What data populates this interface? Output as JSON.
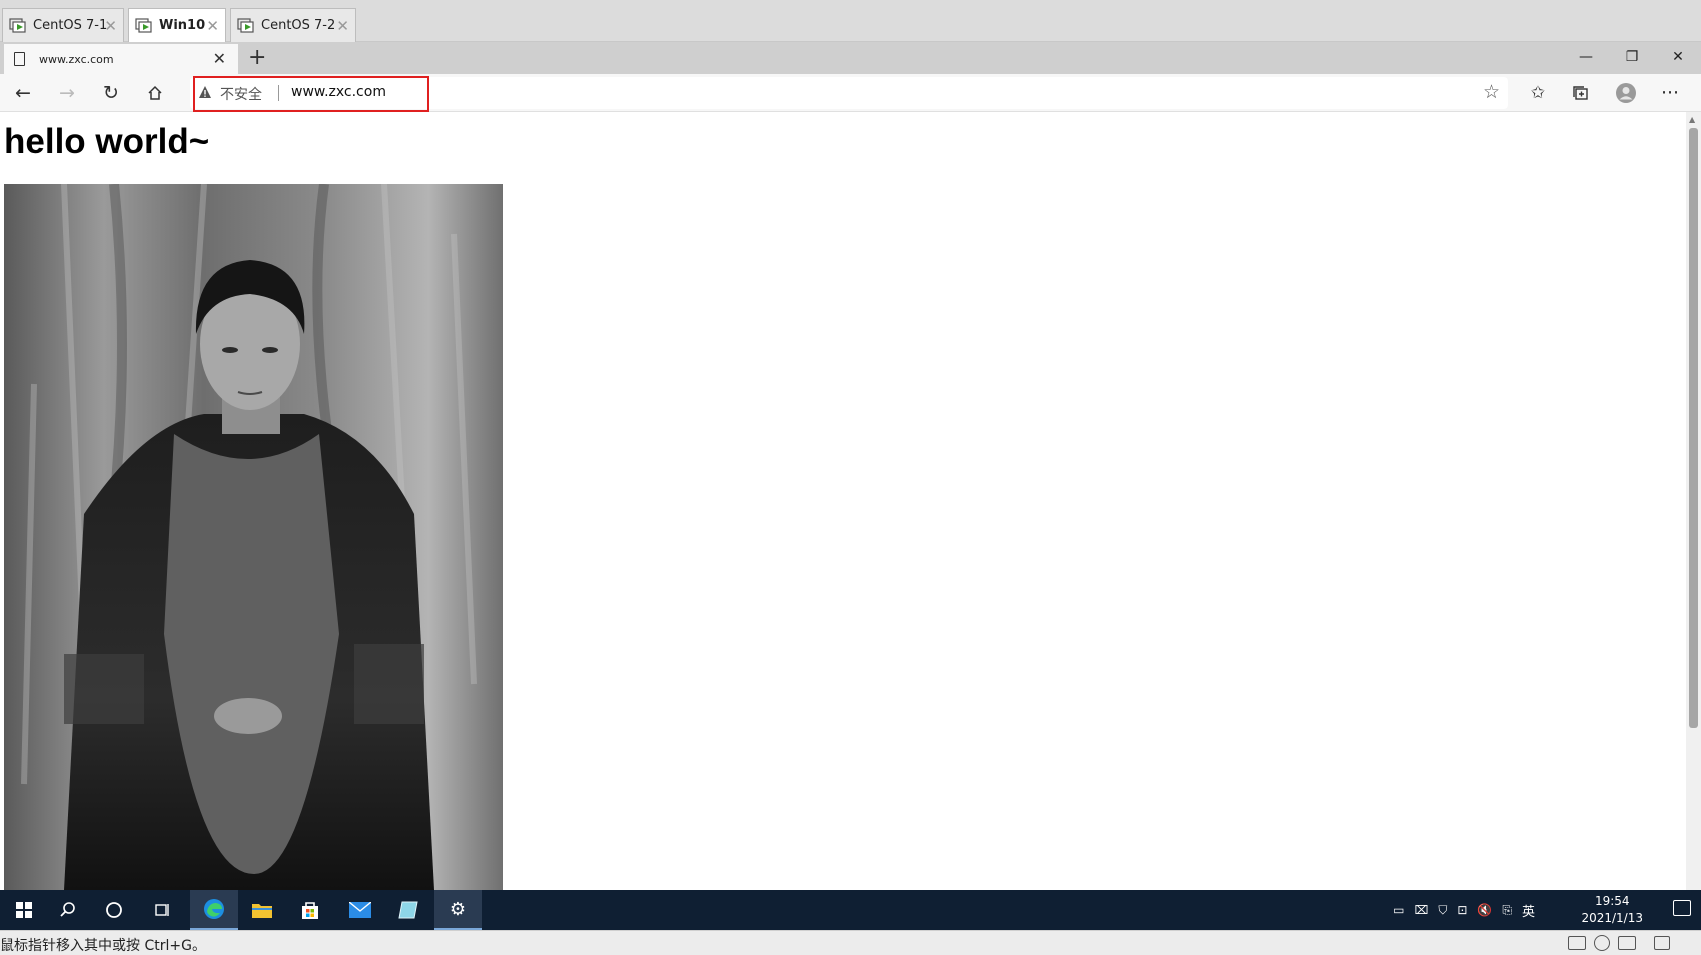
{
  "vm_tabs": [
    {
      "label": "CentOS 7-1",
      "active": false
    },
    {
      "label": "Win10",
      "active": true
    },
    {
      "label": "CentOS 7-2",
      "active": false
    }
  ],
  "browser": {
    "tab_title": "www.zxc.com",
    "new_tab_icon": "plus-icon",
    "window_controls": {
      "minimize": "—",
      "restore": "❐",
      "close": "✕"
    },
    "address": {
      "security_text": "不安全",
      "url": "www.zxc.com"
    },
    "icons": [
      "back-arrow-icon",
      "forward-arrow-icon",
      "refresh-icon",
      "home-icon",
      "star-icon",
      "favorites-icon",
      "collections-icon",
      "profile-icon",
      "more-icon"
    ]
  },
  "page": {
    "heading": "hello world~",
    "image_alt": "black-and-white portrait photo of a young man in a sweater and coat"
  },
  "taskbar": {
    "tray_lang": "英",
    "time": "19:54",
    "date": "2021/1/13",
    "accent": "#0f1f33"
  },
  "statusbar": {
    "message": "鼠标指针移入其中或按 Ctrl+G。"
  }
}
